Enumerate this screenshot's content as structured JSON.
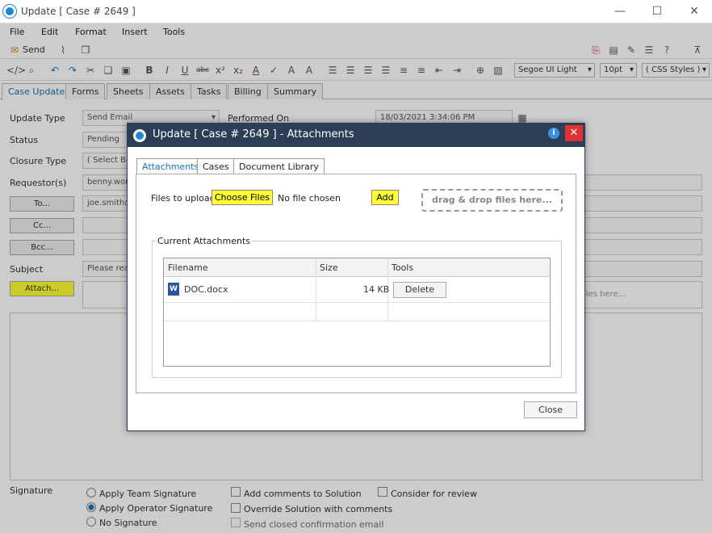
{
  "window": {
    "title": "Update [ Case # 2649 ]",
    "min": "—",
    "max": "☐",
    "close": "✕"
  },
  "menu": [
    "File",
    "Edit",
    "Format",
    "Insert",
    "Tools"
  ],
  "toolbar": {
    "send_label": "Send",
    "font": "Segoe UI Light",
    "size": "10pt",
    "styles": "( CSS Styles )"
  },
  "tabs": [
    "Case Update",
    "Forms",
    "Sheets",
    "Assets",
    "Tasks",
    "Billing",
    "Summary"
  ],
  "form": {
    "update_type_label": "Update Type",
    "update_type_value": "Send Email",
    "performed_on_label": "Performed On",
    "performed_on_value": "18/03/2021 3:34:06 PM",
    "status_label": "Status",
    "status_value": "Pending",
    "closure_type_label": "Closure Type",
    "closure_type_value": "( Select Bo",
    "requestors_label": "Requestor(s)",
    "requestors_value": "benny.wor",
    "to_button": "To...",
    "to_value": "joe.smith@",
    "cc_button": "Cc...",
    "bcc_button": "Bcc...",
    "subject_label": "Subject",
    "subject_value": "Please rea",
    "attach_button": "Attach...",
    "drop_hint": "iles here..."
  },
  "bottom": {
    "signature_label": "Signature",
    "apply_team": "Apply Team Signature",
    "apply_operator": "Apply Operator Signature",
    "no_signature": "No Signature",
    "add_comments": "Add comments to Solution",
    "override_solution": "Override Solution with comments",
    "send_closed": "Send closed confirmation email",
    "consider_review": "Consider for review"
  },
  "dialog": {
    "title": "Update [ Case # 2649 ] - Attachments",
    "tabs": [
      "Attachments",
      "Cases",
      "Document Library"
    ],
    "files_label": "Files to upload:",
    "choose_files": "Choose Files",
    "no_file": "No file chosen",
    "add": "Add",
    "drag_drop": "drag & drop files here...",
    "current_attachments": "Current Attachments",
    "col_filename": "Filename",
    "col_size": "Size",
    "col_tools": "Tools",
    "file_name": "DOC.docx",
    "file_size": "14 KB",
    "delete": "Delete",
    "close": "Close",
    "info": "i",
    "close_x": "✕"
  },
  "colors": {
    "accent": "#1c6fb5",
    "dialog_header": "#2c3e55",
    "highlight": "#ffff33",
    "close_red": "#d33333"
  }
}
